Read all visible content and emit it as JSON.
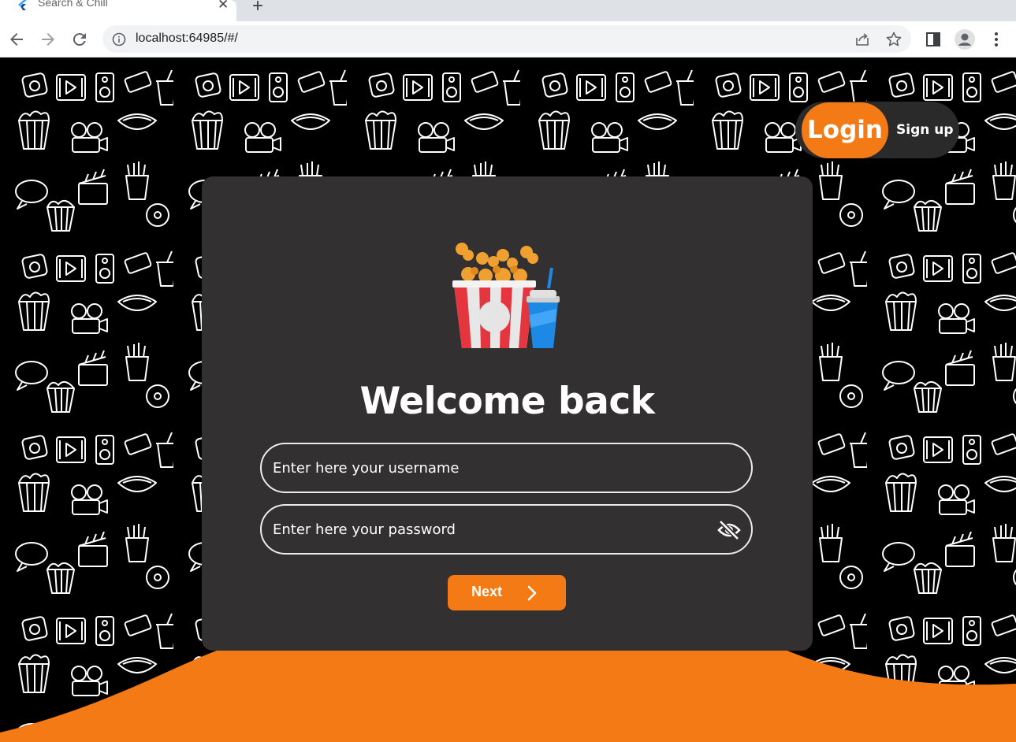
{
  "browser": {
    "tab_title": "Search & Chill",
    "tab_close": "✕",
    "new_tab": "+",
    "url": "localhost:64985/#/",
    "icons": [
      "flutter-icon",
      "back-icon",
      "forward-icon",
      "reload-icon",
      "info-icon",
      "share-icon",
      "star-icon",
      "sidebar-icon",
      "profile-icon",
      "menu-icon"
    ]
  },
  "auth_toggle": {
    "login_label": "Login",
    "signup_label": "Sign up"
  },
  "login_card": {
    "title": "Welcome back",
    "username_placeholder": "Enter here your username",
    "password_placeholder": "Enter here your password",
    "next_label": "Next",
    "icons": [
      "popcorn-soda-icon",
      "eye-off-icon",
      "chevron-right-icon"
    ]
  },
  "colors": {
    "accent": "#f47a16",
    "card": "#323031",
    "background": "#000000"
  }
}
